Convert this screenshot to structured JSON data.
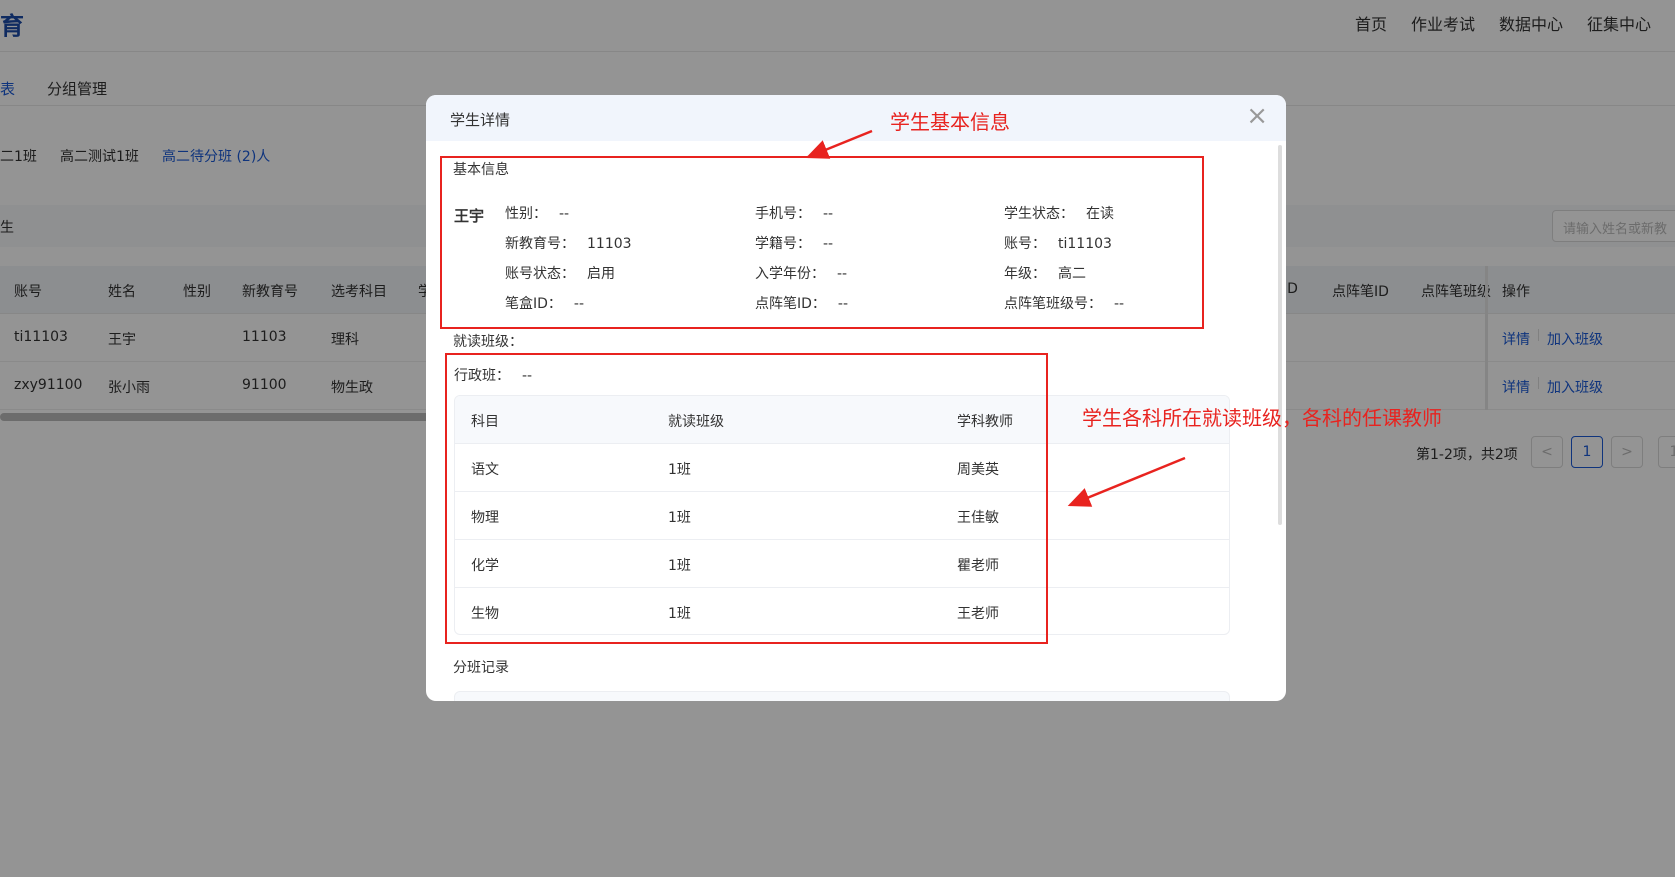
{
  "app": {
    "logo_text": "育"
  },
  "topnav": [
    "首页",
    "作业考试",
    "数据中心",
    "征集中心"
  ],
  "subtabs": {
    "active": "表",
    "other": "分组管理"
  },
  "class_filters": [
    "二1班",
    "高二测试1班",
    "高二待分班 (2)人"
  ],
  "filter_bar": {
    "label": "生"
  },
  "search": {
    "placeholder": "请输入姓名或新教"
  },
  "table": {
    "headers": [
      "账号",
      "姓名",
      "性别",
      "新教育号",
      "选考科目",
      "学",
      "ID",
      "点阵笔ID",
      "点阵笔班级",
      "操作"
    ],
    "rows": [
      {
        "account": "ti11103",
        "name": "王宇",
        "gender": "",
        "edu_no": "11103",
        "subjects": "理科",
        "actions": [
          "详情",
          "加入班级"
        ]
      },
      {
        "account": "zxy91100",
        "name": "张小雨",
        "gender": "",
        "edu_no": "91100",
        "subjects": "物生政",
        "actions": [
          "详情",
          "加入班级"
        ]
      }
    ]
  },
  "pagination": {
    "info": "第1-2项，共2项",
    "prev": "<",
    "current": "1",
    "next": ">",
    "last": "1"
  },
  "modal": {
    "title": "学生详情",
    "close_symbol": "×",
    "basic_section_title": "基本信息",
    "student_name": "王宇",
    "fields": [
      {
        "label": "性别：",
        "value": "--"
      },
      {
        "label": "手机号：",
        "value": "--"
      },
      {
        "label": "学生状态：",
        "value": "在读"
      },
      {
        "label": "新教育号：",
        "value": "11103"
      },
      {
        "label": "学籍号：",
        "value": "--"
      },
      {
        "label": "账号：",
        "value": "ti11103"
      },
      {
        "label": "账号状态：",
        "value": "启用"
      },
      {
        "label": "入学年份：",
        "value": "--"
      },
      {
        "label": "年级：",
        "value": "高二"
      },
      {
        "label": "笔盒ID：",
        "value": "--"
      },
      {
        "label": "点阵笔ID：",
        "value": "--"
      },
      {
        "label": "点阵笔班级号：",
        "value": "--"
      }
    ],
    "class_section_title": "就读班级：",
    "admin_class": {
      "label": "行政班：",
      "value": "--"
    },
    "subject_table": {
      "headers": [
        "科目",
        "就读班级",
        "学科教师"
      ],
      "rows": [
        [
          "语文",
          "1班",
          "周美英"
        ],
        [
          "物理",
          "1班",
          "王佳敏"
        ],
        [
          "化学",
          "1班",
          "瞿老师"
        ],
        [
          "生物",
          "1班",
          "王老师"
        ]
      ]
    },
    "history_section_title": "分班记录"
  },
  "annotations": {
    "basic_info_note": "学生基本信息",
    "class_note": "学生各科所在就读班级，各科的任课教师",
    "color": "#e8231f"
  }
}
